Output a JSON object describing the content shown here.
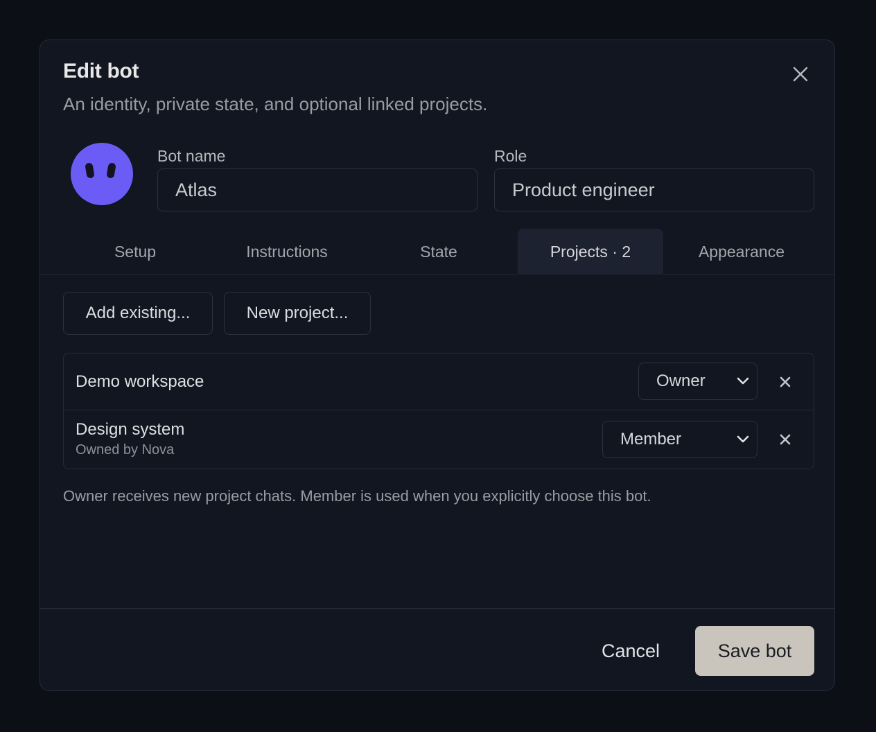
{
  "dialog": {
    "title": "Edit bot",
    "subtitle": "An identity, private state, and optional linked projects.",
    "close_icon": "close-icon"
  },
  "avatar": {
    "icon": "bot-face-icon",
    "color": "#6b5cf6"
  },
  "fields": {
    "bot_name_label": "Bot name",
    "bot_name_value": "Atlas",
    "role_label": "Role",
    "role_value": "Product engineer"
  },
  "tabs": [
    {
      "label": "Setup",
      "active": false
    },
    {
      "label": "Instructions",
      "active": false
    },
    {
      "label": "State",
      "active": false
    },
    {
      "label": "Projects · 2",
      "active": true
    },
    {
      "label": "Appearance",
      "active": false
    }
  ],
  "actions": {
    "add_existing": "Add existing...",
    "new_project": "New project..."
  },
  "projects": [
    {
      "name": "Demo workspace",
      "owner_note": "",
      "role": "Owner"
    },
    {
      "name": "Design system",
      "owner_note": "Owned by Nova",
      "role": "Member"
    }
  ],
  "hint": "Owner receives new project chats. Member is used when you explicitly choose this bot.",
  "footer": {
    "cancel": "Cancel",
    "save": "Save bot"
  },
  "colors": {
    "background": "#0c0f16",
    "dialog": "#121620",
    "accent": "#6b5cf6",
    "primary_button": "#c9c5bd"
  }
}
